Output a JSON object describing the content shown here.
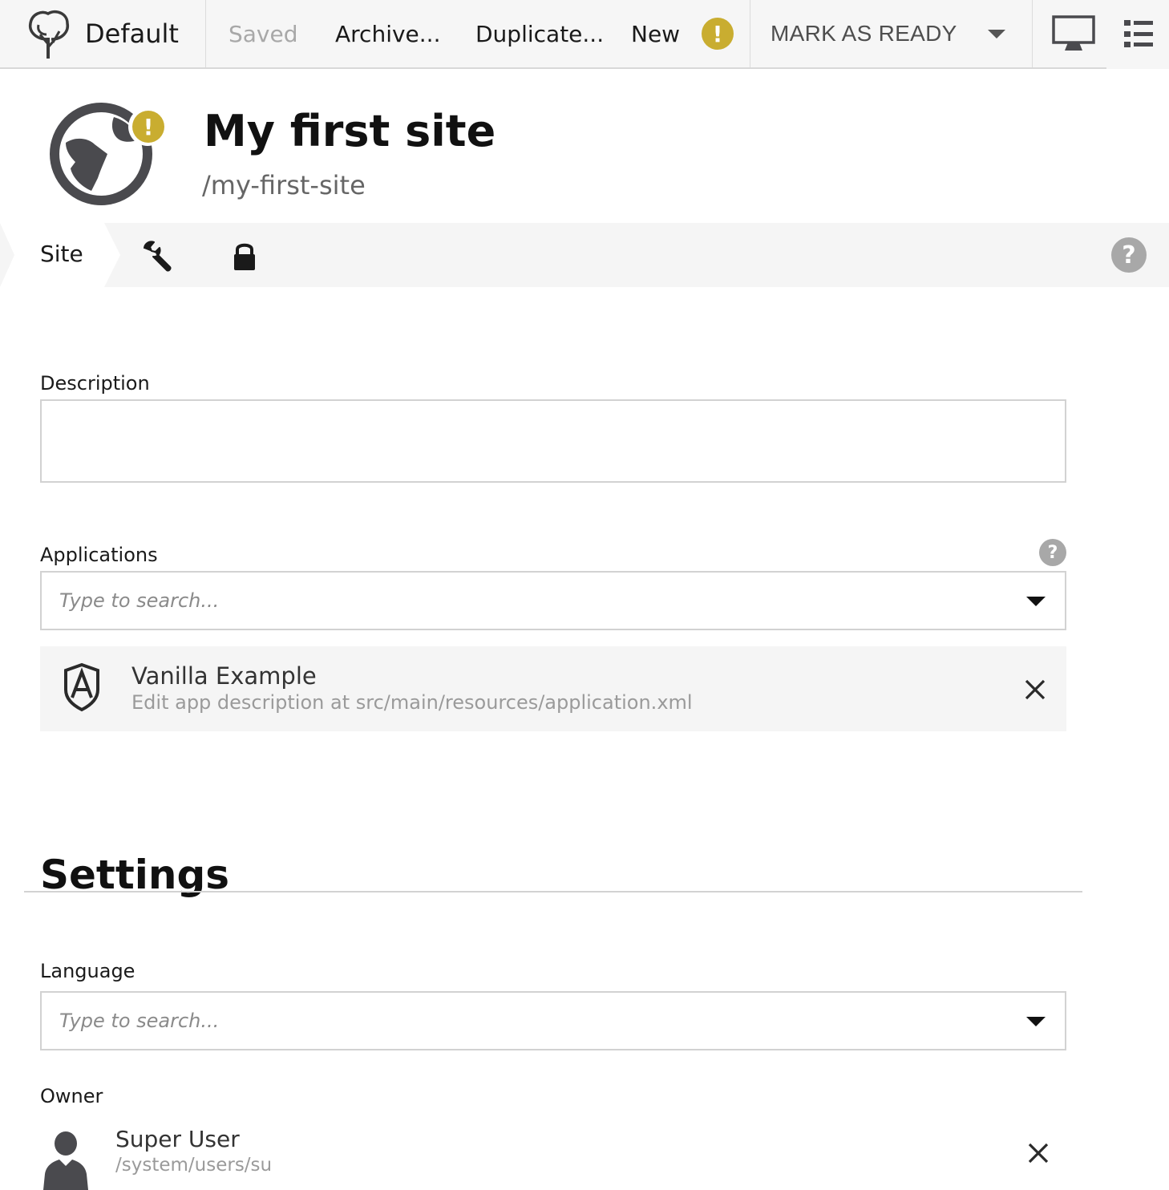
{
  "toolbar": {
    "project_name": "Default",
    "actions": {
      "saved": "Saved",
      "archive": "Archive...",
      "duplicate": "Duplicate...",
      "new": "New"
    },
    "warning_symbol": "!",
    "publish_label": "MARK AS READY",
    "icons": [
      "tree-logo-icon",
      "warning-icon",
      "chevron-down-icon",
      "desktop-preview-icon",
      "list-view-icon"
    ]
  },
  "header": {
    "title": "My first site",
    "path": "/my-first-site",
    "icon": "globe-icon",
    "badge": "!"
  },
  "tabs": {
    "site_label": "Site",
    "icons": [
      "wrench-icon",
      "lock-icon"
    ],
    "help_symbol": "?"
  },
  "form": {
    "description": {
      "label": "Description",
      "value": ""
    },
    "applications": {
      "label": "Applications",
      "placeholder": "Type to search...",
      "help_symbol": "?",
      "items": [
        {
          "name": "Vanilla Example",
          "description": "Edit app description at src/main/resources/application.xml",
          "icon": "app-shield-icon"
        }
      ]
    }
  },
  "settings": {
    "title": "Settings",
    "language": {
      "label": "Language",
      "placeholder": "Type to search..."
    },
    "owner": {
      "label": "Owner",
      "name": "Super User",
      "path": "/system/users/su",
      "icon": "user-icon"
    }
  },
  "colors": {
    "toolbar_bg": "#f6f6f6",
    "warning": "#c9ad30",
    "icon_dark": "#4a4a4e",
    "help_gray": "#a8a8a8",
    "border": "#d2d2d2"
  }
}
